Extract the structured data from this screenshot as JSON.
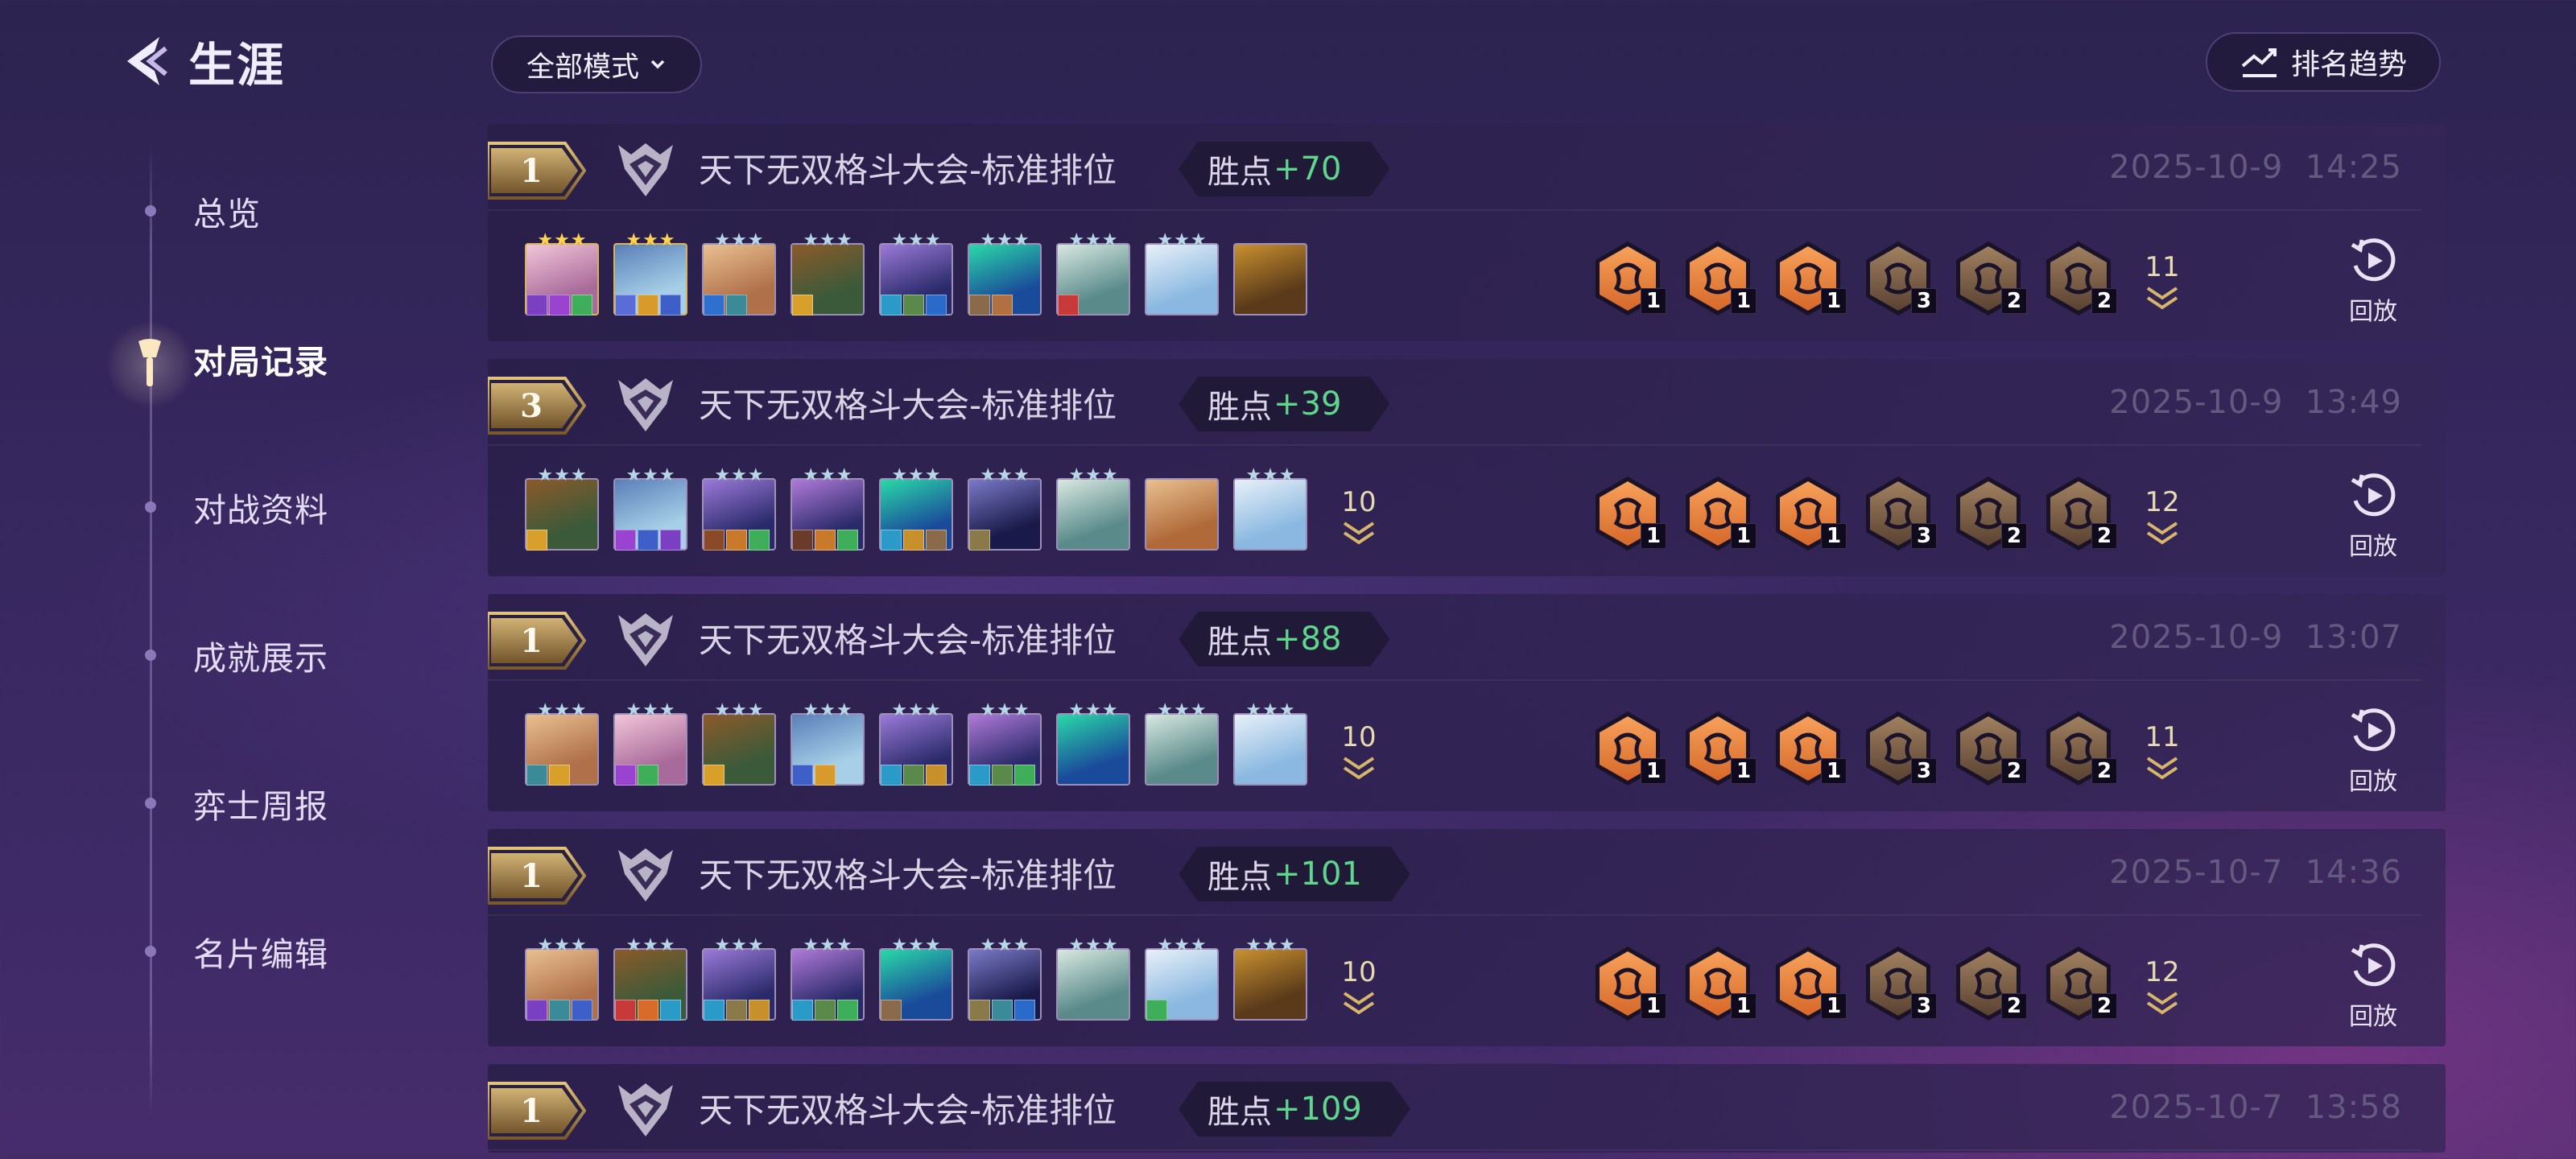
{
  "sidebar": {
    "back_title": "生涯",
    "items": [
      {
        "label": "总览",
        "active": false
      },
      {
        "label": "对局记录",
        "active": true
      },
      {
        "label": "对战资料",
        "active": false
      },
      {
        "label": "成就展示",
        "active": false
      },
      {
        "label": "弈士周报",
        "active": false
      },
      {
        "label": "名片编辑",
        "active": false
      }
    ]
  },
  "toolbar": {
    "mode_filter": "全部模式",
    "trend_button": "排名趋势"
  },
  "matches": [
    {
      "rank": "1",
      "mode": "天下无双格斗大会-标准排位",
      "lp_label": "胜点",
      "lp_value": "+70",
      "date": "2025-10-9",
      "time": "14:25",
      "extra_units": "",
      "traits_total": "11",
      "replay_label": "回放",
      "units": [
        {
          "stars": "gold",
          "c1": "#a86a9a",
          "c2": "#f1c6d8",
          "items": [
            "#7b3fc4",
            "#9a43d0",
            "#3fae5a"
          ]
        },
        {
          "stars": "gold",
          "c1": "#a7d0e8",
          "c2": "#5a7fb8",
          "items": [
            "#5a6cd8",
            "#d89a2a",
            "#3e5fc8"
          ]
        },
        {
          "stars": "silver",
          "c1": "#b0704a",
          "c2": "#e8c090",
          "items": [
            "#2f6fcf",
            "#3a8a9a"
          ]
        },
        {
          "stars": "silver",
          "c1": "#3a5a3a",
          "c2": "#8b5a2a",
          "items": [
            "#d8a02a"
          ]
        },
        {
          "stars": "silver",
          "c1": "#2a2a6a",
          "c2": "#9a7ad8",
          "items": [
            "#2a9ac8",
            "#5a8a4a",
            "#2a6aca"
          ]
        },
        {
          "stars": "silver",
          "c1": "#1a4a9a",
          "c2": "#2ad8a8",
          "items": [
            "#8a6a4a",
            "#b07040"
          ]
        },
        {
          "stars": "silver",
          "c1": "#5a8a8a",
          "c2": "#d8e8e0",
          "items": [
            "#c83a3a"
          ]
        },
        {
          "stars": "silver",
          "c1": "#8ab8e0",
          "c2": "#e8f0f8",
          "items": []
        },
        {
          "stars": "none",
          "c1": "#5a3a1a",
          "c2": "#c89030",
          "items": []
        }
      ],
      "traits": [
        {
          "tier": "orange",
          "count": "1"
        },
        {
          "tier": "orange",
          "count": "1"
        },
        {
          "tier": "orange",
          "count": "1"
        },
        {
          "tier": "bronze",
          "count": "3"
        },
        {
          "tier": "bronze",
          "count": "2"
        },
        {
          "tier": "bronze",
          "count": "2"
        }
      ]
    },
    {
      "rank": "3",
      "mode": "天下无双格斗大会-标准排位",
      "lp_label": "胜点",
      "lp_value": "+39",
      "date": "2025-10-9",
      "time": "13:49",
      "extra_units": "10",
      "traits_total": "12",
      "replay_label": "回放",
      "units": [
        {
          "stars": "silver",
          "c1": "#3a5a3a",
          "c2": "#8b5a2a",
          "items": [
            "#d8a02a"
          ]
        },
        {
          "stars": "silver",
          "c1": "#a7d0e8",
          "c2": "#5a7fb8",
          "items": [
            "#9a43d0",
            "#3e5fc8",
            "#7b3fc4"
          ]
        },
        {
          "stars": "silver",
          "c1": "#2a2a6a",
          "c2": "#9a7ad8",
          "items": [
            "#8a4a2a",
            "#c87a2a",
            "#3fae5a"
          ]
        },
        {
          "stars": "silver",
          "c1": "#2a2a6a",
          "c2": "#b07ad8",
          "items": [
            "#6a3a2a",
            "#c87a2a",
            "#3fae5a"
          ]
        },
        {
          "stars": "silver",
          "c1": "#1a4a9a",
          "c2": "#2ad8a8",
          "items": [
            "#2a9ac8",
            "#c8902a",
            "#8a6a4a"
          ]
        },
        {
          "stars": "silver",
          "c1": "#1a1a4a",
          "c2": "#7a7ac8",
          "items": [
            "#8a7a4a"
          ]
        },
        {
          "stars": "silver",
          "c1": "#5a8a8a",
          "c2": "#d8e8e0",
          "items": []
        },
        {
          "stars": "none",
          "c1": "#b06a3a",
          "c2": "#e8c090",
          "items": []
        },
        {
          "stars": "silver",
          "c1": "#8ab8e0",
          "c2": "#e8f0f8",
          "items": []
        }
      ],
      "traits": [
        {
          "tier": "orange",
          "count": "1"
        },
        {
          "tier": "orange",
          "count": "1"
        },
        {
          "tier": "orange",
          "count": "1"
        },
        {
          "tier": "bronze",
          "count": "3"
        },
        {
          "tier": "bronze",
          "count": "2"
        },
        {
          "tier": "bronze",
          "count": "2"
        }
      ]
    },
    {
      "rank": "1",
      "mode": "天下无双格斗大会-标准排位",
      "lp_label": "胜点",
      "lp_value": "+88",
      "date": "2025-10-9",
      "time": "13:07",
      "extra_units": "10",
      "traits_total": "11",
      "replay_label": "回放",
      "units": [
        {
          "stars": "silver",
          "c1": "#b0704a",
          "c2": "#e8c090",
          "items": [
            "#3a8a9a",
            "#d8a02a"
          ]
        },
        {
          "stars": "silver",
          "c1": "#a86a9a",
          "c2": "#f1c6d8",
          "items": [
            "#9a43d0",
            "#3fae5a"
          ]
        },
        {
          "stars": "silver",
          "c1": "#3a5a3a",
          "c2": "#8b5a2a",
          "items": [
            "#d8a02a"
          ]
        },
        {
          "stars": "silver",
          "c1": "#a7d0e8",
          "c2": "#5a7fb8",
          "items": [
            "#3e5fc8",
            "#d89a2a"
          ]
        },
        {
          "stars": "silver",
          "c1": "#2a2a6a",
          "c2": "#9a7ad8",
          "items": [
            "#2a9ac8",
            "#5a8a4a",
            "#c8902a"
          ]
        },
        {
          "stars": "silver",
          "c1": "#2a2a6a",
          "c2": "#b07ad8",
          "items": [
            "#2a9ac8",
            "#5a8a4a",
            "#3fae5a"
          ]
        },
        {
          "stars": "silver",
          "c1": "#1a4a9a",
          "c2": "#2ad8a8",
          "items": []
        },
        {
          "stars": "silver",
          "c1": "#5a8a8a",
          "c2": "#d8e8e0",
          "items": []
        },
        {
          "stars": "silver",
          "c1": "#8ab8e0",
          "c2": "#e8f0f8",
          "items": []
        }
      ],
      "traits": [
        {
          "tier": "orange",
          "count": "1"
        },
        {
          "tier": "orange",
          "count": "1"
        },
        {
          "tier": "orange",
          "count": "1"
        },
        {
          "tier": "bronze",
          "count": "3"
        },
        {
          "tier": "bronze",
          "count": "2"
        },
        {
          "tier": "bronze",
          "count": "2"
        }
      ]
    },
    {
      "rank": "1",
      "mode": "天下无双格斗大会-标准排位",
      "lp_label": "胜点",
      "lp_value": "+101",
      "date": "2025-10-7",
      "time": "14:36",
      "extra_units": "10",
      "traits_total": "12",
      "replay_label": "回放",
      "units": [
        {
          "stars": "silver",
          "c1": "#b0704a",
          "c2": "#e8c090",
          "items": [
            "#7b3fc4",
            "#3a8a9a",
            "#3e5fc8"
          ]
        },
        {
          "stars": "silver",
          "c1": "#3a5a3a",
          "c2": "#8b5a2a",
          "items": [
            "#c83a3a",
            "#d86a2a",
            "#2a9ac8"
          ]
        },
        {
          "stars": "silver",
          "c1": "#2a2a6a",
          "c2": "#9a7ad8",
          "items": [
            "#2a9ac8",
            "#8a7a4a",
            "#c8902a"
          ]
        },
        {
          "stars": "silver",
          "c1": "#2a2a6a",
          "c2": "#b07ad8",
          "items": [
            "#2a9ac8",
            "#5a8a4a",
            "#3fae5a"
          ]
        },
        {
          "stars": "silver",
          "c1": "#1a4a9a",
          "c2": "#2ad8a8",
          "items": [
            "#8a6a4a"
          ]
        },
        {
          "stars": "silver",
          "c1": "#1a1a4a",
          "c2": "#7a7ac8",
          "items": [
            "#8a7a4a",
            "#3a8a9a",
            "#2a6aca"
          ]
        },
        {
          "stars": "silver",
          "c1": "#5a8a8a",
          "c2": "#d8e8e0",
          "items": []
        },
        {
          "stars": "silver",
          "c1": "#8ab8e0",
          "c2": "#e8f0f8",
          "items": [
            "#3fae5a"
          ]
        },
        {
          "stars": "silver",
          "c1": "#5a3a1a",
          "c2": "#c89030",
          "items": []
        }
      ],
      "traits": [
        {
          "tier": "orange",
          "count": "1"
        },
        {
          "tier": "orange",
          "count": "1"
        },
        {
          "tier": "orange",
          "count": "1"
        },
        {
          "tier": "bronze",
          "count": "3"
        },
        {
          "tier": "bronze",
          "count": "2"
        },
        {
          "tier": "bronze",
          "count": "2"
        }
      ]
    },
    {
      "rank": "1",
      "mode": "天下无双格斗大会-标准排位",
      "lp_label": "胜点",
      "lp_value": "+109",
      "date": "2025-10-7",
      "time": "13:58",
      "partial": true
    }
  ],
  "icons": {
    "back": "chevron-left-icon",
    "dropdown": "chevron-down-icon",
    "trend": "trend-chart-icon",
    "mode": "crest-icon",
    "replay": "replay-icon",
    "active_nav": "torch-icon"
  },
  "colors": {
    "lp_positive": "#5fd68c",
    "rank_gold": "#c8a052",
    "trait_orange": "#e8873a",
    "trait_bronze": "#8a6a4a"
  }
}
